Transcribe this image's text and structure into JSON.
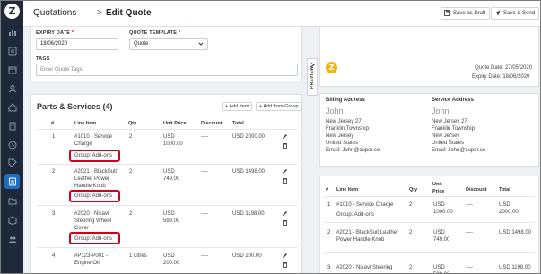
{
  "header": {
    "breadcrumb_root": "Quotations",
    "breadcrumb_sep": ">",
    "breadcrumb_current": "Edit Quote",
    "save_draft_label": "Save as Draft",
    "save_send_label": "Save & Send"
  },
  "form": {
    "expiry_label": "EXPIRY DATE",
    "expiry_value": "18/06/2020",
    "template_label": "QUOTE TEMPLATE",
    "template_value": "Quote",
    "tags_label": "TAGS",
    "tags_placeholder": "Enter Quote Tags",
    "required_mark": "*"
  },
  "parts": {
    "title": "Parts & Services (4)",
    "add_item_label": "+ Add Item",
    "add_group_label": "+ Add from Group",
    "columns": [
      "#",
      "Line Item",
      "Qty",
      "Unit Price",
      "Discount",
      "Total"
    ],
    "rows": [
      {
        "num": "1",
        "item": "#1010 - Service Charge",
        "qty": "2",
        "unit": "USD 1000.00",
        "discount": "----",
        "total": "USD 2000.00",
        "group": "Group: Add-ons"
      },
      {
        "num": "2",
        "item": "#2021 - BlackSuit Leather Power Handle Knob",
        "qty": "2",
        "unit": "USD 749.00",
        "discount": "----",
        "total": "USD 1498.00",
        "group": "Group: Add-ons"
      },
      {
        "num": "3",
        "item": "#2020 - Nikavi Steering Wheel Cover",
        "qty": "2",
        "unit": "USD 599.00",
        "discount": "----",
        "total": "USD 1198.00",
        "group": "Group: Add-ons"
      },
      {
        "num": "4",
        "item": "#P123-P001 - Engine Oil",
        "qty": "1 Litres",
        "unit": "USD 200.00",
        "discount": "----",
        "total": "USD 200.00",
        "group": ""
      }
    ]
  },
  "preview": {
    "tab_label": "PREVIEW",
    "quote_date": "Quote Date: 27/05/2020",
    "expiry_date": "Expiry Date: 18/06/2020",
    "billing": {
      "label": "Billing Address",
      "name": "John",
      "lines": [
        "New Jersey 27",
        "Franklin Township",
        "New Jersey",
        "United States",
        "Email: John@zuper.co"
      ]
    },
    "service": {
      "label": "Service Address",
      "name": "John",
      "lines": [
        "New Jersey 27",
        "Franklin Township",
        "New Jersey",
        "United States",
        "Email: John@zuper.co"
      ]
    },
    "columns": [
      "#",
      "Line Item",
      "Qty",
      "Unit Price",
      "Discount",
      "Total"
    ],
    "rows": [
      {
        "num": "1",
        "item": "#1010 - Service Charge",
        "qty": "2",
        "unit": "USD 1000.00",
        "discount": "----",
        "total": "USD 2000.00",
        "group": "Group: Add-ons"
      },
      {
        "num": "2",
        "item": "#2021 - BlackSuit Leather Power Handle Knob",
        "qty": "2",
        "unit": "USD 749.00",
        "discount": "----",
        "total": "USD 1498.00"
      },
      {
        "num": "3",
        "item": "#2020 - Nikavi Steering",
        "qty": "2",
        "unit": "USD 599.00",
        "discount": "----",
        "total": "USD 1198.00"
      }
    ]
  },
  "colors": {
    "sidebar": "#1e2a39",
    "active": "#1f6fbf",
    "highlight": "#d0021b",
    "logo_accent": "#f6b40e"
  }
}
